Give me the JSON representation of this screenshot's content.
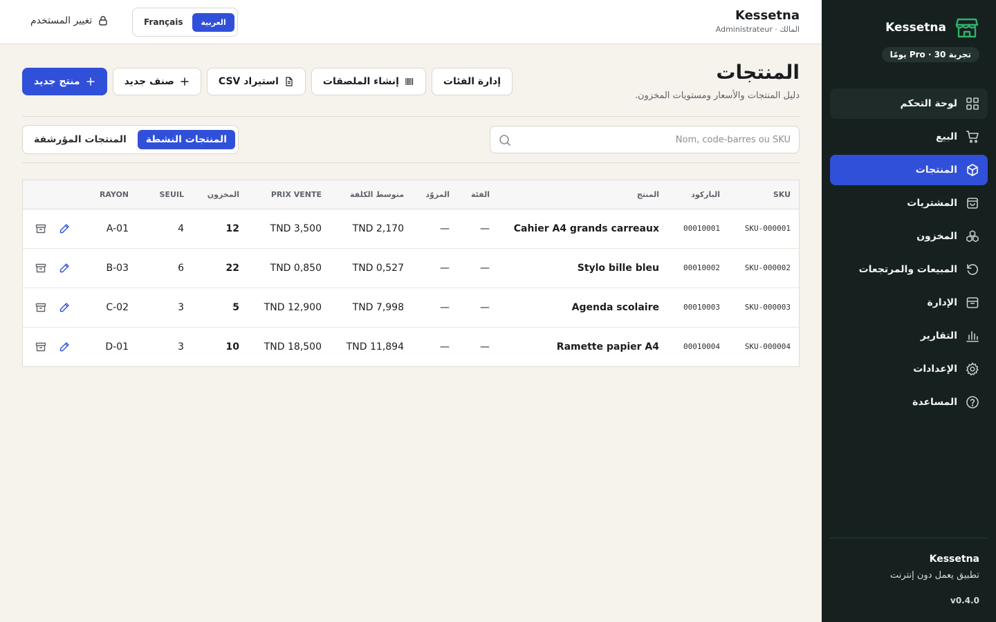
{
  "app": {
    "name": "Kessetna",
    "trial_badge": "تجربة Pro · 30 يومًا"
  },
  "sidebar": {
    "items": [
      {
        "label": "لوحة التحكم"
      },
      {
        "label": "البيع"
      },
      {
        "label": "المنتجات"
      },
      {
        "label": "المشتريات"
      },
      {
        "label": "المخزون"
      },
      {
        "label": "المبيعات والمرتجعات"
      },
      {
        "label": "الإدارة"
      },
      {
        "label": "التقارير"
      },
      {
        "label": "الإعدادات"
      },
      {
        "label": "المساعدة"
      }
    ],
    "footer": {
      "name": "Kessetna",
      "desc": "تطبيق يعمل دون إنترنت",
      "version": "v0.4.0"
    }
  },
  "topbar": {
    "title": "Kessetna",
    "subtitle": "المالك · Administrateur",
    "lang_fr": "Français",
    "lang_ar": "العربية",
    "switch_user": "تغيير المستخدم"
  },
  "page": {
    "title": "المنتجات",
    "subtitle": "دليل المنتجات والأسعار ومستويات المخزون."
  },
  "actions": {
    "manage_categories": "إدارة الفئات",
    "create_labels": "إنشاء الملصقات",
    "import_csv": "استيراد CSV",
    "new_category": "صنف جديد",
    "new_product": "منتج جديد"
  },
  "search": {
    "placeholder": "Nom, code-barres ou SKU"
  },
  "filter": {
    "active": "المنتجات النشطة",
    "archived": "المنتجات المؤرشفة"
  },
  "table": {
    "headers": {
      "sku": "SKU",
      "barcode": "الباركود",
      "product": "المنتج",
      "category": "الفئة",
      "supplier": "المزوّد",
      "avg_cost": "متوسط الكلفة",
      "price": "PRIX VENTE",
      "stock": "المخزون",
      "threshold": "SEUIL",
      "rayon": "RAYON"
    },
    "rows": [
      {
        "sku": "SKU-000001",
        "barcode": "00010001",
        "product": "Cahier A4 grands carreaux",
        "category": "—",
        "supplier": "—",
        "avg_cost": "TND 2,170",
        "price": "TND 3,500",
        "stock": "12",
        "threshold": "4",
        "rayon": "A-01"
      },
      {
        "sku": "SKU-000002",
        "barcode": "00010002",
        "product": "Stylo bille bleu",
        "category": "—",
        "supplier": "—",
        "avg_cost": "TND 0,527",
        "price": "TND 0,850",
        "stock": "22",
        "threshold": "6",
        "rayon": "B-03"
      },
      {
        "sku": "SKU-000003",
        "barcode": "00010003",
        "product": "Agenda scolaire",
        "category": "—",
        "supplier": "—",
        "avg_cost": "TND 7,998",
        "price": "TND 12,900",
        "stock": "5",
        "threshold": "3",
        "rayon": "C-02"
      },
      {
        "sku": "SKU-000004",
        "barcode": "00010004",
        "product": "Ramette papier A4",
        "category": "—",
        "supplier": "—",
        "avg_cost": "TND 11,894",
        "price": "TND 18,500",
        "stock": "10",
        "threshold": "3",
        "rayon": "D-01"
      }
    ]
  },
  "colors": {
    "primary": "#3150d9",
    "sidebar_bg": "#16211f",
    "brand_green": "#2fb36d",
    "page_bg": "#f6f2ec"
  }
}
